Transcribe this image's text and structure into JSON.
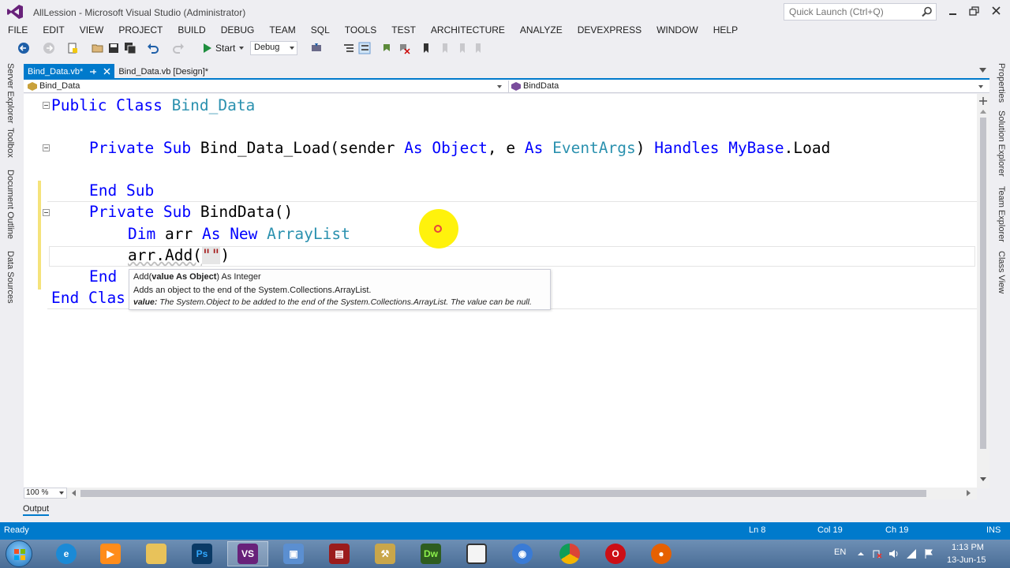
{
  "window": {
    "title": "AllLession - Microsoft Visual Studio (Administrator)",
    "quick_launch_placeholder": "Quick Launch (Ctrl+Q)"
  },
  "menu": [
    "FILE",
    "EDIT",
    "VIEW",
    "PROJECT",
    "BUILD",
    "DEBUG",
    "TEAM",
    "SQL",
    "TOOLS",
    "TEST",
    "ARCHITECTURE",
    "ANALYZE",
    "DEVEXPRESS",
    "WINDOW",
    "HELP"
  ],
  "toolbar": {
    "start_label": "Start",
    "configuration": "Debug"
  },
  "left_rail": [
    "Server Explorer",
    "Toolbox",
    "Document Outline",
    "Data Sources"
  ],
  "right_rail": [
    "Properties",
    "Solution Explorer",
    "Team Explorer",
    "Class View"
  ],
  "tabs": [
    {
      "label": "Bind_Data.vb*",
      "active": true
    },
    {
      "label": "Bind_Data.vb [Design]*",
      "active": false
    }
  ],
  "navigation": {
    "class_dropdown": "Bind_Data",
    "member_dropdown": "BindData"
  },
  "code": {
    "line1": {
      "kw": "Public Class",
      "name": "Bind_Data"
    },
    "line2": {
      "kw1": "Private Sub",
      "name": "Bind_Data_Load(sender",
      "as1": "As",
      "t1": "Object",
      "e": ", e",
      "as2": "As",
      "t2": "EventArgs",
      "close": ")",
      "handles": "Handles",
      "mybase": "MyBase",
      "load": ".Load"
    },
    "line3": {
      "kw": "End Sub"
    },
    "line4": {
      "kw": "Private Sub",
      "name": "BindData()"
    },
    "line5": {
      "kw1": "Dim",
      "var": "arr",
      "kw2": "As New",
      "type": "ArrayList"
    },
    "line6": {
      "text1": "arr.Add(",
      "str": "\"\"",
      "text2": ")"
    },
    "line7": {
      "kw": "End"
    },
    "line8": {
      "kw": "End Clas"
    }
  },
  "tooltip": {
    "sig_name": "Add(",
    "sig_param": "value As Object",
    "sig_rest": ") As Integer",
    "description": "Adds an object to the end of the System.Collections.ArrayList.",
    "param_name": "value:",
    "param_desc": "The System.Object to be added to the end of the System.Collections.ArrayList. The value can be null."
  },
  "zoom": "100 %",
  "output_tab": "Output",
  "status": {
    "ready": "Ready",
    "line": "Ln 8",
    "col": "Col 19",
    "ch": "Ch 19",
    "mode": "INS"
  },
  "tray": {
    "language": "EN",
    "time": "1:13 PM",
    "date": "13-Jun-15"
  },
  "taskbar_apps": [
    "ie-icon",
    "media-player-icon",
    "file-explorer-icon",
    "photoshop-icon",
    "visual-studio-icon",
    "virtualbox-icon",
    "book-app-icon",
    "tools-app-icon",
    "dreamweaver-icon",
    "window-app-icon",
    "network-app-icon",
    "chrome-icon",
    "opera-icon",
    "firefox-icon"
  ],
  "colors": {
    "accent": "#007acc",
    "keyword": "#0000ff",
    "type": "#2b91af"
  }
}
